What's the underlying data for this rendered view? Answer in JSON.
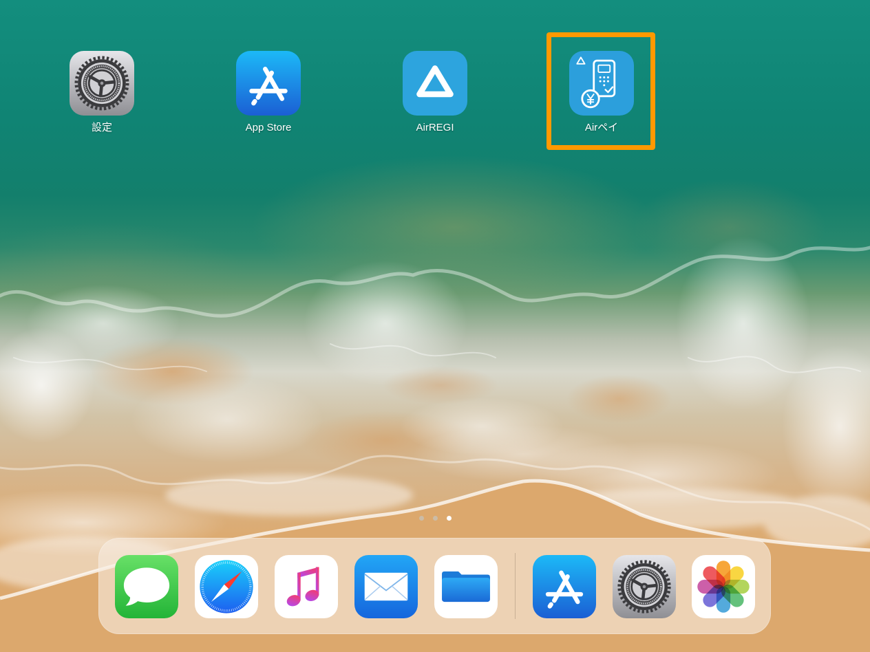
{
  "home_screen": {
    "apps": [
      {
        "label": "設定",
        "icon": "settings-icon"
      },
      {
        "label": "App Store",
        "icon": "app-store-icon"
      },
      {
        "label": "AirREGI",
        "icon": "airregi-icon"
      },
      {
        "label": "Airペイ",
        "icon": "airpay-icon"
      }
    ],
    "highlight": {
      "icon": "airpay-icon",
      "color": "#ff9900"
    }
  },
  "page_indicator": {
    "pages": 3,
    "current_page": 3
  },
  "dock": {
    "apps": [
      {
        "icon": "messages-icon"
      },
      {
        "icon": "safari-icon"
      },
      {
        "icon": "music-icon"
      },
      {
        "icon": "mail-icon"
      },
      {
        "icon": "files-icon"
      }
    ],
    "recent_apps": [
      {
        "icon": "app-store-icon"
      },
      {
        "icon": "settings-icon"
      },
      {
        "icon": "photos-icon"
      }
    ]
  },
  "colors": {
    "label_text": "#ffffff",
    "page_dot_active": "#ffffff",
    "page_dot_inactive": "#c8c0b4"
  }
}
